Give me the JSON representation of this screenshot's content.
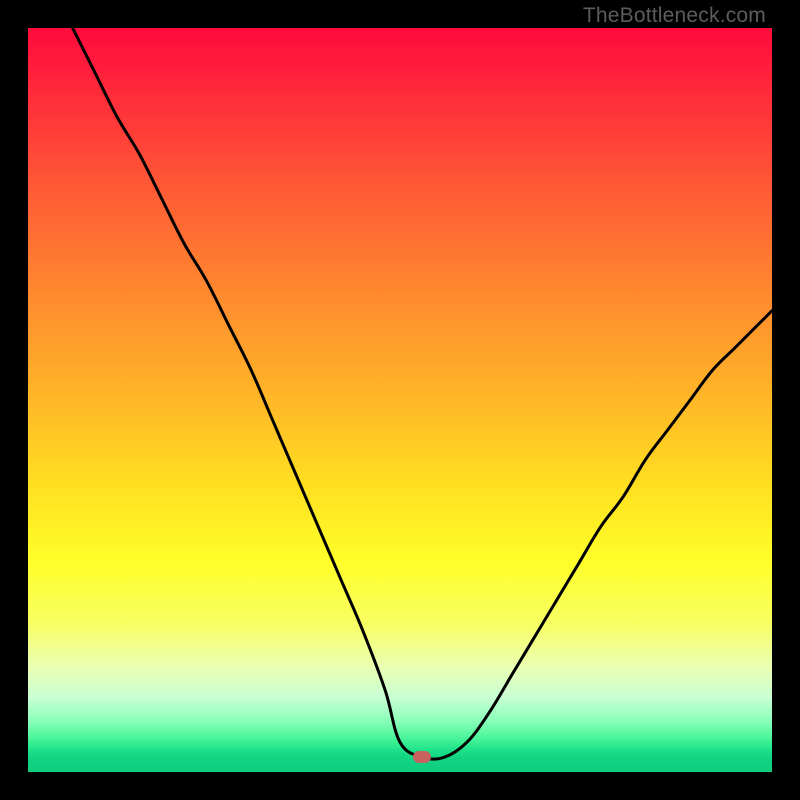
{
  "watermark": "TheBottleneck.com",
  "chart_data": {
    "type": "line",
    "title": "",
    "xlabel": "",
    "ylabel": "",
    "xlim": [
      0,
      100
    ],
    "ylim": [
      0,
      100
    ],
    "grid": false,
    "legend": false,
    "background_gradient": [
      "#ff0a3c",
      "#ff5b35",
      "#ffb727",
      "#ffff2a",
      "#c8ffd4",
      "#0dce7f"
    ],
    "marker": {
      "x": 53,
      "y": 2,
      "color": "#c6635f"
    },
    "series": [
      {
        "name": "curve",
        "color": "#000000",
        "x": [
          6,
          9,
          12,
          15,
          18,
          21,
          24,
          27,
          30,
          33,
          36,
          39,
          42,
          45,
          48,
          50,
          53,
          56,
          59,
          62,
          65,
          68,
          71,
          74,
          77,
          80,
          83,
          86,
          89,
          92,
          95,
          98,
          100
        ],
        "y": [
          100,
          94,
          88,
          83,
          77,
          71,
          66,
          60,
          54,
          47,
          40,
          33,
          26,
          19,
          11,
          4,
          2,
          2,
          4,
          8,
          13,
          18,
          23,
          28,
          33,
          37,
          42,
          46,
          50,
          54,
          57,
          60,
          62
        ]
      }
    ]
  }
}
